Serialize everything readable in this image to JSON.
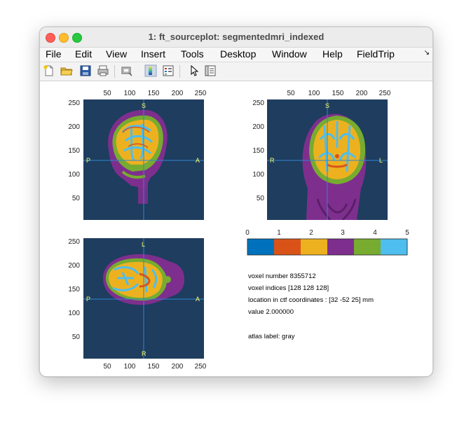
{
  "window": {
    "title": "1: ft_sourceplot: segmentedmri_indexed"
  },
  "menu": {
    "items": [
      "File",
      "Edit",
      "View",
      "Insert",
      "Tools",
      "Desktop",
      "Window",
      "Help",
      "FieldTrip"
    ],
    "overflow_icon": "arrow-icon"
  },
  "toolbar": {
    "buttons": [
      "new-figure-icon",
      "open-file-icon",
      "save-icon",
      "print-icon",
      "link-icon",
      "colorbar-icon",
      "legend-icon",
      "pointer-icon",
      "property-inspector-icon"
    ]
  },
  "plots": {
    "ticks_top": [
      "50",
      "100",
      "150",
      "200",
      "250"
    ],
    "ticks_bottom": [
      "50",
      "100",
      "150",
      "200",
      "250"
    ],
    "ticks_left": [
      "250",
      "200",
      "150",
      "100",
      "50"
    ],
    "sagittal": {
      "top": "S",
      "left": "P",
      "right": "A"
    },
    "coronal": {
      "top": "S",
      "left": "R",
      "right": "L"
    },
    "axial": {
      "top": "L",
      "bottom": "R",
      "left": "P",
      "right": "A"
    }
  },
  "colorbar": {
    "ticks": [
      "0",
      "1",
      "2",
      "3",
      "4",
      "5"
    ],
    "colors": [
      "#0072bd",
      "#d95319",
      "#edb120",
      "#7e2f8e",
      "#77ac30",
      "#4dbeee"
    ]
  },
  "info": {
    "voxel_number": "voxel number 8355712",
    "voxel_indices": "voxel indices [128 128 128]",
    "location": "location in ctf coordinates : [32 -52 25] mm",
    "value": "value 2.000000",
    "atlas_label": "atlas label: gray"
  },
  "colors": {
    "background_slice": "#1e3d5f",
    "crosshair": "#2e86d0",
    "orientation_labels": "#ffff66"
  }
}
